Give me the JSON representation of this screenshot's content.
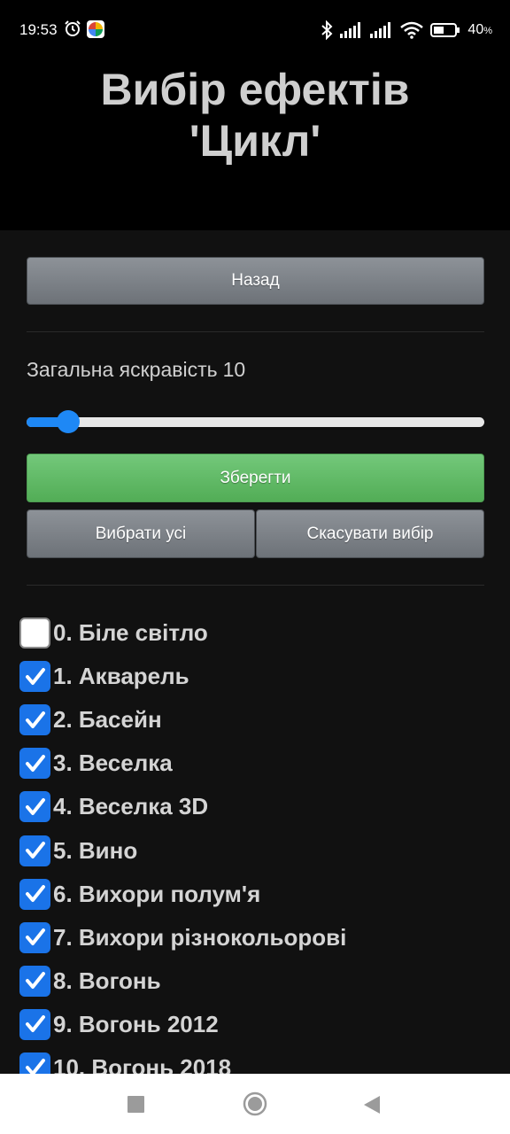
{
  "status_bar": {
    "time": "19:53",
    "battery": "40",
    "battery_unit": "%"
  },
  "header": {
    "title_line1": "Вибір ефектів",
    "title_line2": "'Цикл'"
  },
  "controls": {
    "back_label": "Назад",
    "brightness_label": "Загальна яскравість",
    "brightness_value": "10",
    "brightness_fraction": 0.09,
    "save_label": "Зберегти",
    "select_all_label": "Вибрати усі",
    "deselect_label": "Скасувати вибір"
  },
  "effects": [
    {
      "label": "0. Біле світло",
      "checked": false
    },
    {
      "label": "1. Акварель",
      "checked": true
    },
    {
      "label": "2. Басейн",
      "checked": true
    },
    {
      "label": "3. Веселка",
      "checked": true
    },
    {
      "label": "4. Веселка 3D",
      "checked": true
    },
    {
      "label": "5. Вино",
      "checked": true
    },
    {
      "label": "6. Вихори полум'я",
      "checked": true
    },
    {
      "label": "7. Вихори різнокольорові",
      "checked": true
    },
    {
      "label": "8. Вогонь",
      "checked": true
    },
    {
      "label": "9. Вогонь 2012",
      "checked": true
    },
    {
      "label": "10. Вогонь 2018",
      "checked": true
    }
  ],
  "colors": {
    "accent": "#1e88f5",
    "save_green": "#5fba64",
    "background": "#111111"
  }
}
